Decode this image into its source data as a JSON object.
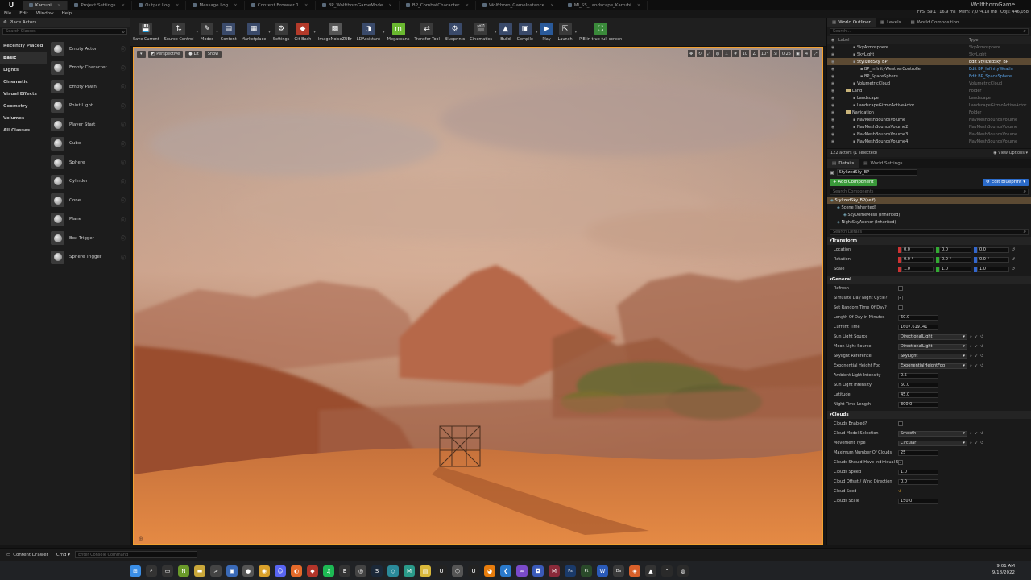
{
  "window": {
    "project_name": "WolfthornGame",
    "tabs": [
      {
        "label": "Karrubi",
        "active": true
      },
      {
        "label": "Project Settings"
      },
      {
        "label": "Output Log"
      },
      {
        "label": "Message Log"
      },
      {
        "label": "Content Browser 1"
      },
      {
        "label": "BP_WolfthornGameMode"
      },
      {
        "label": "BP_CombatCharacter"
      },
      {
        "label": "Wolfthorn_GameInstance"
      },
      {
        "label": "MI_SS_Landscape_Karrubi"
      }
    ]
  },
  "menu": [
    "File",
    "Edit",
    "Window",
    "Help"
  ],
  "stats": {
    "fps": "FPS: 59.1",
    "ms": "16.9 ms",
    "mem": "Mem: 7,074.18 mb",
    "objs": "Objs: 446,058"
  },
  "place_actors": {
    "title": "Place Actors",
    "search_placeholder": "Search Classes",
    "categories": [
      "Recently Placed",
      "Basic",
      "Lights",
      "Cinematic",
      "Visual Effects",
      "Geometry",
      "Volumes",
      "All Classes"
    ],
    "active_category": "Basic",
    "items": [
      "Empty Actor",
      "Empty Character",
      "Empty Pawn",
      "Point Light",
      "Player Start",
      "Cube",
      "Sphere",
      "Cylinder",
      "Cone",
      "Plane",
      "Box Trigger",
      "Sphere Trigger"
    ]
  },
  "toolbar": [
    {
      "label": "Save Current",
      "icon": "save-icon",
      "color": "#3a3a3a"
    },
    {
      "label": "Source Control",
      "icon": "source-control-icon",
      "color": "#3a3a3a"
    },
    {
      "label": "Modes",
      "icon": "modes-icon",
      "color": "#3a3a3a"
    },
    {
      "label": "Content",
      "icon": "content-icon",
      "color": "#3a4a6a"
    },
    {
      "label": "Marketplace",
      "icon": "marketplace-icon",
      "color": "#3a4a6a"
    },
    {
      "label": "Settings",
      "icon": "settings-icon",
      "color": "#3a3a3a"
    },
    {
      "label": "Git Bash",
      "icon": "git-bash-icon",
      "color": "#b33a2a"
    },
    {
      "label": "ImageNoiseZUEr",
      "icon": "image-noise-icon",
      "color": "#555"
    },
    {
      "label": "LDAssistant",
      "icon": "ld-assistant-icon",
      "color": "#3a4a6a"
    },
    {
      "label": "Megascans",
      "icon": "megascans-icon",
      "color": "#6ab830"
    },
    {
      "label": "Transfer Tool",
      "icon": "transfer-tool-icon",
      "color": "#3a3a3a"
    },
    {
      "label": "Blueprints",
      "icon": "blueprints-icon",
      "color": "#3a4a6a"
    },
    {
      "label": "Cinematics",
      "icon": "cinematics-icon",
      "color": "#3a3a3a"
    },
    {
      "label": "Build",
      "icon": "build-icon",
      "color": "#3a4a6a"
    },
    {
      "label": "Compile",
      "icon": "compile-icon",
      "color": "#3a4a6a"
    },
    {
      "label": "Play",
      "icon": "play-icon",
      "color": "#2a5a9a"
    },
    {
      "label": "Launch",
      "icon": "launch-icon",
      "color": "#3a3a3a"
    },
    {
      "label": "PIE in true full screen",
      "icon": "pie-fullscreen-icon",
      "color": "#3a8a3a"
    }
  ],
  "viewport": {
    "perspective_label": "Perspective",
    "lit_label": "Lit",
    "show_label": "Show",
    "grid_snap": "10",
    "rot_snap": "10°",
    "scale_snap": "0.25",
    "camera_speed": "4"
  },
  "outliner": {
    "tabs": [
      "World Outliner",
      "Levels",
      "World Composition"
    ],
    "search_placeholder": "Search...",
    "col_label": "Label",
    "col_type": "Type",
    "rows": [
      {
        "name": "SkyAtmosphere",
        "type": "SkyAtmosphere",
        "indent": 2
      },
      {
        "name": "SkyLight",
        "type": "SkyLight",
        "indent": 2
      },
      {
        "name": "StylizedSky_BP",
        "type": "Edit StylizedSky_BP",
        "indent": 2,
        "selected": true
      },
      {
        "name": "BP_InfinityWeatherController",
        "type": "Edit BP_InfinityWeathr",
        "indent": 3,
        "link": true
      },
      {
        "name": "BP_SpaceSphere",
        "type": "Edit BP_SpaceSphere",
        "indent": 3,
        "link": true
      },
      {
        "name": "VolumetricCloud",
        "type": "VolumetricCloud",
        "indent": 2
      },
      {
        "name": "Land",
        "type": "Folder",
        "indent": 1,
        "folder": true
      },
      {
        "name": "Landscape",
        "type": "Landscape",
        "indent": 2
      },
      {
        "name": "LandscapeGizmoActiveActor",
        "type": "LandscapeGizmoActiveActor",
        "indent": 2
      },
      {
        "name": "Navigation",
        "type": "Folder",
        "indent": 1,
        "folder": true
      },
      {
        "name": "NavMeshBoundsVolume",
        "type": "NavMeshBoundsVolume",
        "indent": 2
      },
      {
        "name": "NavMeshBoundsVolume2",
        "type": "NavMeshBoundsVolume",
        "indent": 2
      },
      {
        "name": "NavMeshBoundsVolume3",
        "type": "NavMeshBoundsVolume",
        "indent": 2
      },
      {
        "name": "NavMeshBoundsVolume4",
        "type": "NavMeshBoundsVolume",
        "indent": 2
      }
    ],
    "count": "122 actors (1 selected)",
    "view_options": "View Options"
  },
  "details": {
    "tabs": [
      "Details",
      "World Settings"
    ],
    "actor_name": "StylizedSky_BP",
    "add_component": "+ Add Component",
    "edit_blueprint": "Edit Blueprint",
    "components_placeholder": "Search Components",
    "components": [
      {
        "name": "StylizedSky_BP(self)",
        "indent": 0,
        "selected": true
      },
      {
        "name": "Scene (Inherited)",
        "indent": 1
      },
      {
        "name": "SkyDomeMesh (Inherited)",
        "indent": 2
      },
      {
        "name": "NightSkyAnchor (Inherited)",
        "indent": 1
      }
    ],
    "details_placeholder": "Search Details",
    "transform": {
      "title": "Transform",
      "rows": [
        {
          "label": "Location",
          "x": "0.0",
          "y": "0.0",
          "z": "0.0"
        },
        {
          "label": "Rotation",
          "x": "0.0 °",
          "y": "0.0 °",
          "z": "0.0 °"
        },
        {
          "label": "Scale",
          "x": "1.0",
          "y": "1.0",
          "z": "1.0"
        }
      ]
    },
    "general": {
      "title": "General",
      "rows": [
        {
          "label": "Refresh",
          "kind": "check",
          "checked": false
        },
        {
          "label": "Simulate Day Night Cycle?",
          "kind": "check",
          "checked": true
        },
        {
          "label": "Set Random Time Of Day?",
          "kind": "check",
          "checked": false
        },
        {
          "label": "Length Of Day in Minutes",
          "kind": "num",
          "value": "60.0"
        },
        {
          "label": "Current Time",
          "kind": "num",
          "value": "1607.619141"
        },
        {
          "label": "Sun Light Source",
          "kind": "dd",
          "value": "DirectionalLight"
        },
        {
          "label": "Moon Light Source",
          "kind": "dd",
          "value": "DirectionalLight"
        },
        {
          "label": "Skylight Reference",
          "kind": "dd",
          "value": "SkyLight"
        },
        {
          "label": "Exponential Height Fog",
          "kind": "dd",
          "value": "ExponentialHeightFog"
        },
        {
          "label": "Ambient Light Intensity",
          "kind": "num",
          "value": "0.5"
        },
        {
          "label": "Sun Light Intensity",
          "kind": "num",
          "value": "60.0"
        },
        {
          "label": "Latitude",
          "kind": "num",
          "value": "45.0"
        },
        {
          "label": "Night Time Length",
          "kind": "num",
          "value": "300.0"
        }
      ]
    },
    "clouds": {
      "title": "Clouds",
      "rows": [
        {
          "label": "Clouds Enabled?",
          "kind": "check",
          "checked": false
        },
        {
          "label": "Cloud Model Selection",
          "kind": "dd",
          "value": "Smooth"
        },
        {
          "label": "Movement Type",
          "kind": "dd",
          "value": "Circular"
        },
        {
          "label": "Maximum Number Of Clouds",
          "kind": "num",
          "value": "25"
        },
        {
          "label": "Clouds Should Have Individual S",
          "kind": "check",
          "checked": true
        },
        {
          "label": "Clouds Speed",
          "kind": "num",
          "value": "1.0"
        },
        {
          "label": "Cloud Offset / Wind Direction",
          "kind": "num",
          "value": "0.0"
        },
        {
          "label": "Cloud Seed",
          "kind": "reset",
          "value": ""
        },
        {
          "label": "Clouds Scale",
          "kind": "num",
          "value": "150.0"
        }
      ]
    }
  },
  "bottom": {
    "content_drawer": "Content Drawer",
    "cmd": "Cmd",
    "console_placeholder": "Enter Console Command"
  },
  "clock": {
    "time": "9:01 AM",
    "date": "9/18/2022"
  },
  "taskbar_icons": [
    {
      "name": "windows-start-icon",
      "color": "#3a8ee6",
      "glyph": "⊞"
    },
    {
      "name": "taskbar-search-icon",
      "color": "#333",
      "glyph": "⌕"
    },
    {
      "name": "task-view-icon",
      "color": "#333",
      "glyph": "▭"
    },
    {
      "name": "nvidia-icon",
      "color": "#6a9a2a",
      "glyph": "N"
    },
    {
      "name": "file-explorer-icon",
      "color": "#c9a73a",
      "glyph": "▬"
    },
    {
      "name": "terminal-icon",
      "color": "#444",
      "glyph": ">"
    },
    {
      "name": "photos-icon",
      "color": "#3a6ab8",
      "glyph": "▣"
    },
    {
      "name": "obs-icon",
      "color": "#555",
      "glyph": "●"
    },
    {
      "name": "chrome-icon",
      "color": "#d9a02a",
      "glyph": "◉"
    },
    {
      "name": "discord-icon",
      "color": "#5865f2",
      "glyph": "☺"
    },
    {
      "name": "firefox-icon",
      "color": "#e56a2a",
      "glyph": "◐"
    },
    {
      "name": "app-icon-red",
      "color": "#b3352a",
      "glyph": "◆"
    },
    {
      "name": "spotify-icon",
      "color": "#1db954",
      "glyph": "♫"
    },
    {
      "name": "epic-games-icon",
      "color": "#333",
      "glyph": "E"
    },
    {
      "name": "github-icon",
      "color": "#444",
      "glyph": "◎"
    },
    {
      "name": "steam-icon",
      "color": "#1b2838",
      "glyph": "S"
    },
    {
      "name": "app-icon-teal",
      "color": "#2a8a9a",
      "glyph": "◇"
    },
    {
      "name": "megascans-bridge-icon",
      "color": "#2a9a8a",
      "glyph": "M"
    },
    {
      "name": "sticky-notes-icon",
      "color": "#d9b83a",
      "glyph": "▤"
    },
    {
      "name": "unreal-engine-icon",
      "color": "#222",
      "glyph": "U"
    },
    {
      "name": "app-icon-gray",
      "color": "#555",
      "glyph": "⬡"
    },
    {
      "name": "unreal-engine-5-icon",
      "color": "#222",
      "glyph": "U"
    },
    {
      "name": "blender-icon",
      "color": "#e87d0d",
      "glyph": "◕"
    },
    {
      "name": "vscode-icon",
      "color": "#2a7acc",
      "glyph": "❮"
    },
    {
      "name": "visual-studio-icon",
      "color": "#7a4ac9",
      "glyph": "∞"
    },
    {
      "name": "app-icon-blue",
      "color": "#3a5ab8",
      "glyph": "◘"
    },
    {
      "name": "app-icon-maroon",
      "color": "#8a2a3a",
      "glyph": "M"
    },
    {
      "name": "photoshop-icon",
      "color": "#1a3a6a",
      "glyph": "Ps"
    },
    {
      "name": "substance-painter-icon",
      "color": "#2a4a2a",
      "glyph": "Pt"
    },
    {
      "name": "word-icon",
      "color": "#2a5ab8",
      "glyph": "W"
    },
    {
      "name": "substance-designer-icon",
      "color": "#3a3a3a",
      "glyph": "Ds"
    },
    {
      "name": "app-icon-orange",
      "color": "#d9602a",
      "glyph": "◈"
    },
    {
      "name": "app-icon-dark",
      "color": "#333",
      "glyph": "▲"
    },
    {
      "name": "tray-icon-1",
      "color": "#2a2a2a",
      "glyph": "⌃"
    },
    {
      "name": "tray-icon-2",
      "color": "#2a2a2a",
      "glyph": "◍"
    }
  ],
  "colors": {
    "accent": "#f2a030",
    "selection": "#5c4a33",
    "link": "#5aa2e6",
    "add_component": "#3a9a3a",
    "edit_blueprint": "#2a6ac9"
  }
}
